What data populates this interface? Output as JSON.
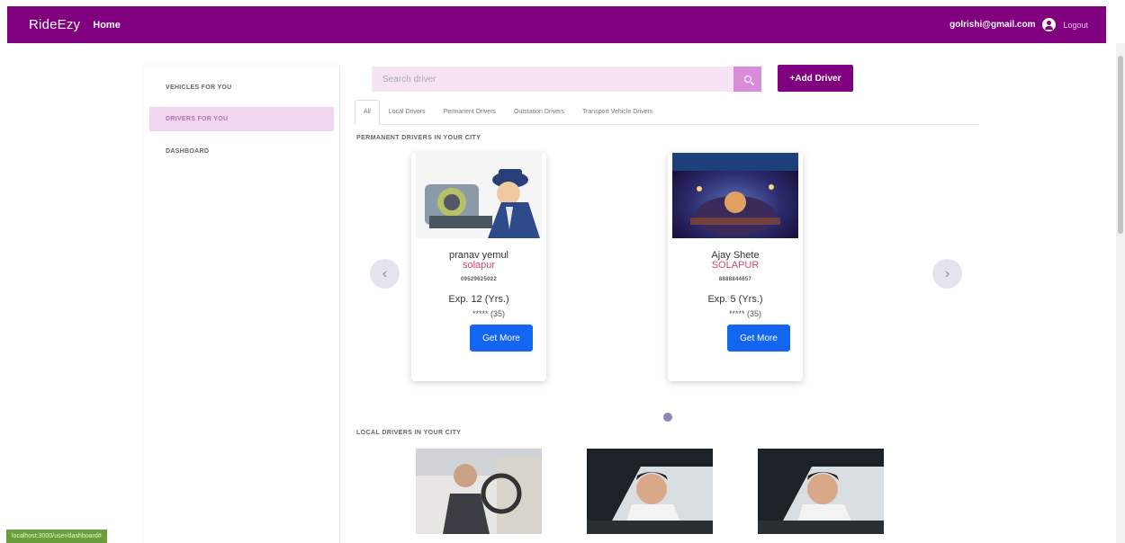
{
  "navbar": {
    "brand": "RideEzy",
    "home": "Home",
    "email": "golrishi@gmail.com",
    "logout": "Logout"
  },
  "sidebar": {
    "items": [
      {
        "label": "VEHICLES FOR YOU",
        "active": false
      },
      {
        "label": "DRIVERS FOR YOU",
        "active": true
      },
      {
        "label": "DASHBOARD",
        "active": false
      }
    ]
  },
  "search": {
    "placeholder": "Search driver"
  },
  "add_driver_label": "+Add Driver",
  "tabs": [
    "All",
    "Local Drivers",
    "Permanent Drivers",
    "Outstation Drivers",
    "Transport Vehicle Drivers"
  ],
  "sections": {
    "permanent_title": "PERMANENT DRIVERS IN YOUR CITY",
    "local_title": "LOCAL DRIVERS IN YOUR CITY"
  },
  "permanent_drivers": [
    {
      "name": "pranav yemul",
      "city": "solapur",
      "phone": "09529625022",
      "experience": "Exp. 12 (Yrs.)",
      "rating": "***** (35)",
      "button": "Get More"
    },
    {
      "name": "Ajay Shete",
      "city": "SOLAPUR",
      "phone": "8888844657",
      "experience": "Exp. 5 (Yrs.)",
      "rating": "***** (35)",
      "button": "Get More"
    }
  ],
  "status_url": "localhost:3000/user/dashboard#",
  "colors": {
    "brand": "#800080",
    "primary_button": "#1266f1",
    "city_text": "#d04a6a"
  }
}
